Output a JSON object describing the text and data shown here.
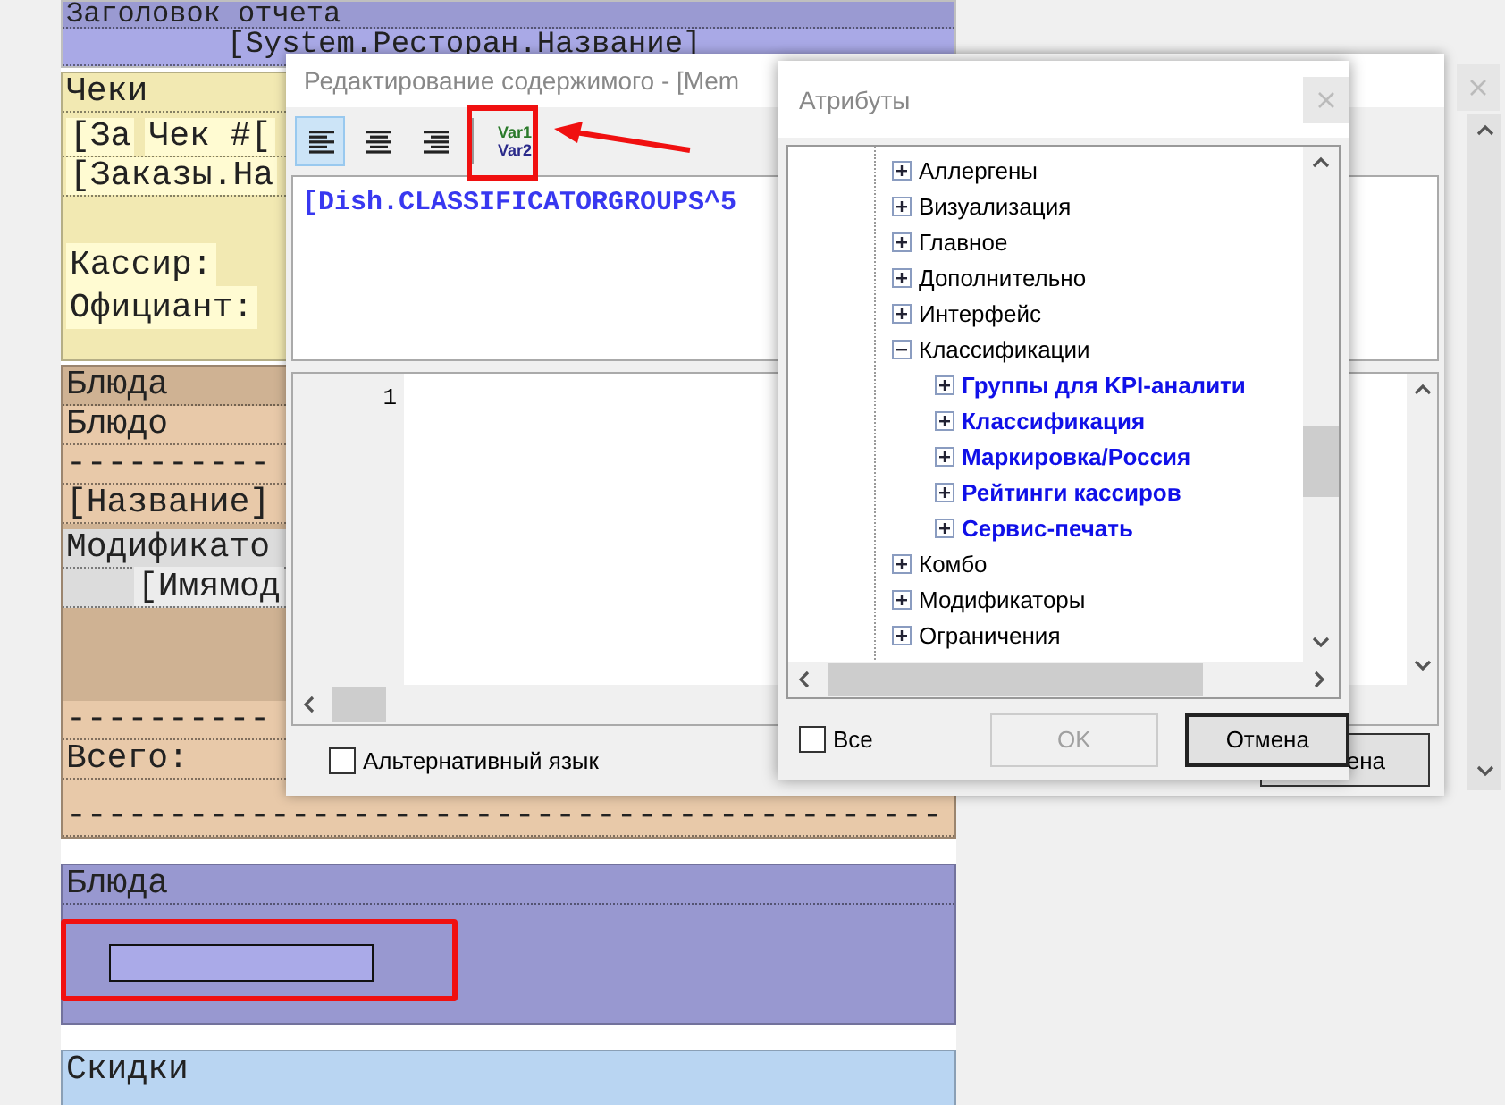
{
  "report_bands": [
    {
      "kind": "title",
      "label": "Заголовок отчета",
      "field": "[System.Ресторан.Название]"
    },
    {
      "kind": "checks",
      "label": "Чеки",
      "row_1": [
        "[За",
        "Чек #["
      ],
      "row_2": "[Заказы.На",
      "captions": [
        "Кассир:",
        "Официант:"
      ]
    },
    {
      "kind": "dishes",
      "label": "Блюда",
      "header": "Блюдо",
      "rule_1": "----------",
      "name_field": "[Название]",
      "modifiers_label": "Модификато",
      "modifier_field": "[Имямод",
      "rule_2": "----------",
      "total_label": "Всего:",
      "rule_3": "-------------------------------------------"
    },
    {
      "kind": "dishes_data",
      "label": "Блюда"
    },
    {
      "kind": "discounts",
      "label": "Скидки"
    }
  ],
  "editor_dialog": {
    "title": "Редактирование содержимого - [Mem",
    "toolbar": [
      {
        "kind": "align-left",
        "selected": true
      },
      {
        "kind": "align-center",
        "selected": false
      },
      {
        "kind": "align-right",
        "selected": false
      },
      {
        "kind": "variables",
        "line_1": "Var1",
        "line_2": "Var2"
      }
    ],
    "expression": "[Dish.CLASSIFICATORGROUPS^5",
    "line_numbers": [
      "1"
    ],
    "alt_language": {
      "label": "Альтернативный язык",
      "checked": false
    },
    "cancel_button": "ена"
  },
  "attributes_dialog": {
    "title": "Атрибуты",
    "tree": [
      {
        "label": "Аллергены",
        "expanded": false
      },
      {
        "label": "Визуализация",
        "expanded": false
      },
      {
        "label": "Главное",
        "expanded": false
      },
      {
        "label": "Дополнительно",
        "expanded": false
      },
      {
        "label": "Интерфейс",
        "expanded": false
      },
      {
        "label": "Классификации",
        "expanded": true,
        "children": [
          {
            "label": "Группы для KPI-аналити",
            "expanded": false
          },
          {
            "label": "Классификация",
            "expanded": false
          },
          {
            "label": "Маркировка/Россия",
            "expanded": false
          },
          {
            "label": "Рейтинги кассиров",
            "expanded": false
          },
          {
            "label": "Сервис-печать",
            "expanded": false
          }
        ]
      },
      {
        "label": "Комбо",
        "expanded": false
      },
      {
        "label": "Модификаторы",
        "expanded": false
      },
      {
        "label": "Ограничения",
        "expanded": false
      }
    ],
    "all_checkbox": {
      "label": "Все",
      "checked": false
    },
    "ok_button": {
      "label": "OK",
      "disabled": true
    },
    "cancel_button": {
      "label": "Отмена",
      "disabled": false
    }
  }
}
